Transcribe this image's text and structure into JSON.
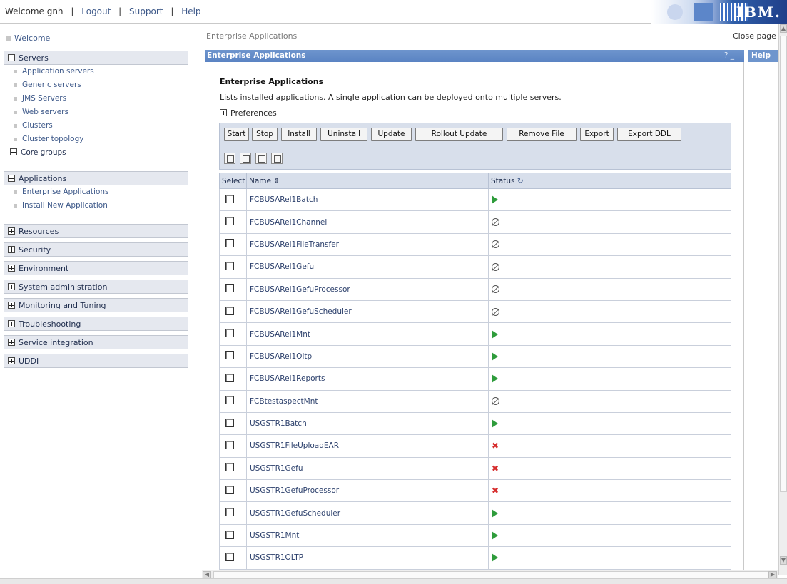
{
  "banner": {
    "welcome": "Welcome gnh",
    "logout": "Logout",
    "support": "Support",
    "help": "Help",
    "separator": "|",
    "logo_text": "IBM."
  },
  "nav": {
    "welcome": "Welcome",
    "groups": [
      {
        "label": "Servers",
        "expanded": true,
        "items": [
          "Application servers",
          "Generic servers",
          "JMS Servers",
          "Web servers",
          "Clusters",
          "Cluster topology"
        ],
        "sub_label": "Core groups"
      },
      {
        "label": "Applications",
        "expanded": true,
        "items": [
          "Enterprise Applications",
          "Install New Application"
        ]
      },
      {
        "label": "Resources",
        "expanded": false
      },
      {
        "label": "Security",
        "expanded": false
      },
      {
        "label": "Environment",
        "expanded": false
      },
      {
        "label": "System administration",
        "expanded": false
      },
      {
        "label": "Monitoring and Tuning",
        "expanded": false
      },
      {
        "label": "Troubleshooting",
        "expanded": false
      },
      {
        "label": "Service integration",
        "expanded": false
      },
      {
        "label": "UDDI",
        "expanded": false
      }
    ]
  },
  "main": {
    "breadcrumb": "Enterprise Applications",
    "close_page": "Close page",
    "panel_title": "Enterprise Applications",
    "panel_controls": "? _",
    "help_title": "Help",
    "heading": "Enterprise Applications",
    "description": "Lists installed applications. A single application can be deployed onto multiple servers.",
    "preferences": "Preferences",
    "buttons": [
      "Start",
      "Stop",
      "Install",
      "Uninstall",
      "Update",
      "Rollout Update",
      "Remove File",
      "Export",
      "Export DDL"
    ],
    "toolbar_icons": [
      "select-all-icon",
      "deselect-all-icon",
      "show-filter-icon",
      "clear-filter-icon"
    ],
    "table": {
      "headers": {
        "select": "Select",
        "name": "Name",
        "status": "Status"
      },
      "rows": [
        {
          "name": "FCBUSARel1Batch",
          "status": "running"
        },
        {
          "name": "FCBUSARel1Channel",
          "status": "stopped"
        },
        {
          "name": "FCBUSARel1FileTransfer",
          "status": "stopped"
        },
        {
          "name": "FCBUSARel1Gefu",
          "status": "stopped"
        },
        {
          "name": "FCBUSARel1GefuProcessor",
          "status": "stopped"
        },
        {
          "name": "FCBUSARel1GefuScheduler",
          "status": "stopped"
        },
        {
          "name": "FCBUSARel1Mnt",
          "status": "running"
        },
        {
          "name": "FCBUSARel1Oltp",
          "status": "running"
        },
        {
          "name": "FCBUSARel1Reports",
          "status": "running"
        },
        {
          "name": "FCBtestaspectMnt",
          "status": "stopped"
        },
        {
          "name": "USGSTR1Batch",
          "status": "running"
        },
        {
          "name": "USGSTR1FileUploadEAR",
          "status": "error"
        },
        {
          "name": "USGSTR1Gefu",
          "status": "error"
        },
        {
          "name": "USGSTR1GefuProcessor",
          "status": "error"
        },
        {
          "name": "USGSTR1GefuScheduler",
          "status": "running"
        },
        {
          "name": "USGSTR1Mnt",
          "status": "running"
        },
        {
          "name": "USGSTR1OLTP",
          "status": "running"
        }
      ]
    }
  },
  "colors": {
    "title_bar": "#6e95cd",
    "panel_bg": "#d8dfeb",
    "running": "#2e9c3b",
    "error": "#d62d2d",
    "link": "#3f5a8a"
  }
}
